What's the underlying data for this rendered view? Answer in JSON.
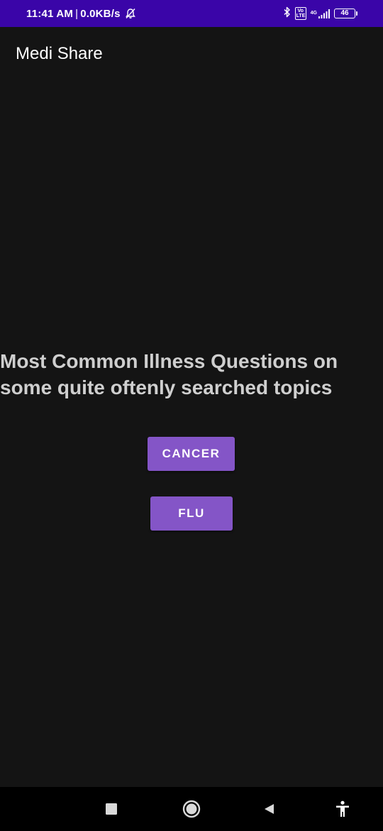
{
  "status_bar": {
    "time": "11:41 AM",
    "separator": "|",
    "net_speed": "0.0KB/s",
    "volte_label": "Vo LTE",
    "network_gen": "4G",
    "battery_level": "46",
    "icons": [
      "bell-off-icon",
      "bluetooth-icon",
      "volte-icon",
      "signal-icon",
      "battery-icon"
    ]
  },
  "app_bar": {
    "title": "Medi Share"
  },
  "main": {
    "headline": "Most Common Illness Questions on some quite oftenly searched topics",
    "buttons": [
      {
        "label": "CANCER"
      },
      {
        "label": "FLU"
      }
    ]
  },
  "nav_bar": {
    "icons": [
      "recents-square-icon",
      "home-circle-icon",
      "back-triangle-icon",
      "accessibility-icon"
    ]
  },
  "colors": {
    "status_bar_bg": "#3a05a8",
    "background": "#141414",
    "button_bg": "#8455c7",
    "headline_text": "#cfcfcf",
    "nav_bar_bg": "#000000"
  }
}
